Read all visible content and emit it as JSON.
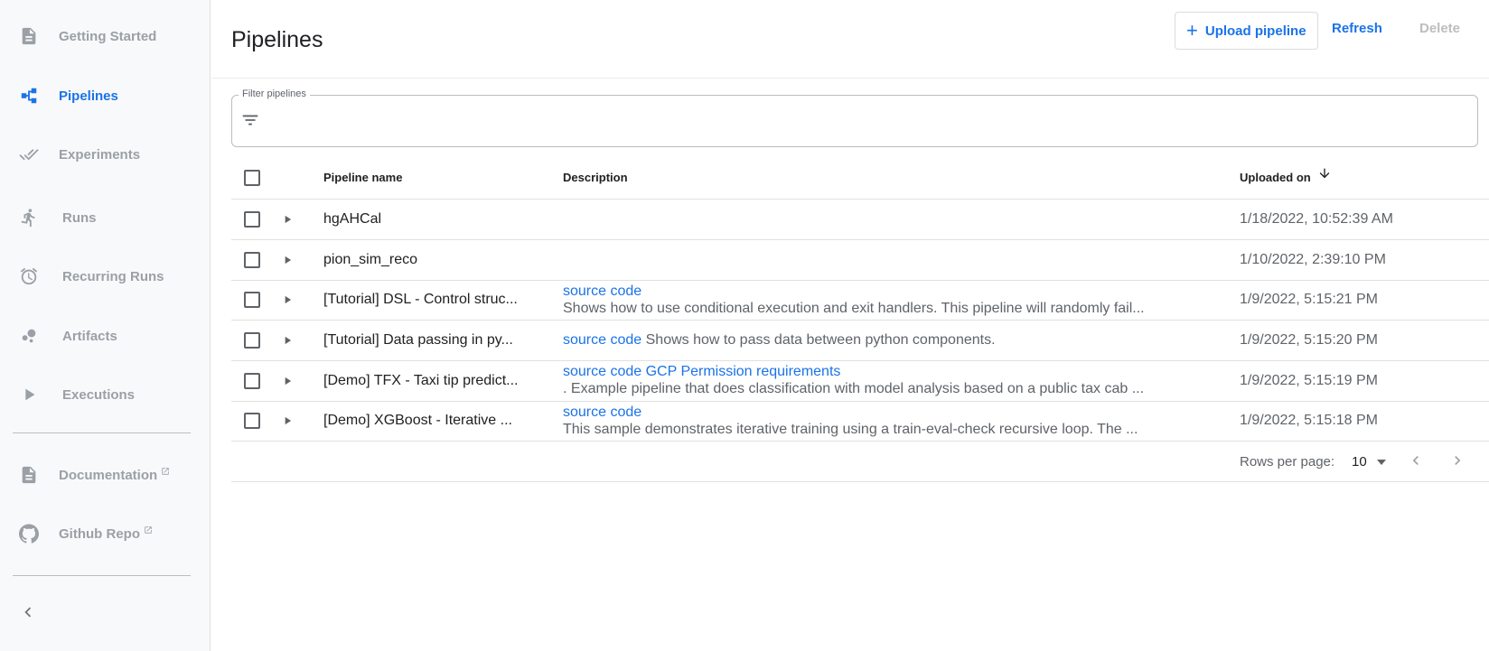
{
  "sidebar": {
    "items": [
      {
        "label": "Getting Started",
        "icon": "document-icon",
        "active": false
      },
      {
        "label": "Pipelines",
        "icon": "pipeline-icon",
        "active": true
      },
      {
        "label": "Experiments",
        "icon": "double-check-icon",
        "active": false
      },
      {
        "label": "Runs",
        "icon": "running-person-icon",
        "active": false
      },
      {
        "label": "Recurring Runs",
        "icon": "alarm-clock-icon",
        "active": false
      },
      {
        "label": "Artifacts",
        "icon": "bubbles-icon",
        "active": false
      },
      {
        "label": "Executions",
        "icon": "play-icon",
        "active": false
      }
    ],
    "external": [
      {
        "label": "Documentation",
        "icon": "document-icon"
      },
      {
        "label": "Github Repo",
        "icon": "github-icon"
      }
    ]
  },
  "header": {
    "title": "Pipelines",
    "upload_label": "Upload pipeline",
    "refresh_label": "Refresh",
    "delete_label": "Delete"
  },
  "filter": {
    "legend": "Filter pipelines",
    "value": ""
  },
  "table": {
    "columns": {
      "name": "Pipeline name",
      "description": "Description",
      "uploaded": "Uploaded on"
    },
    "sort": {
      "column": "uploaded",
      "direction": "descending"
    },
    "rows": [
      {
        "name": "hgAHCal",
        "links": "",
        "description": "",
        "uploaded": "1/18/2022, 10:52:39 AM"
      },
      {
        "name": "pion_sim_reco",
        "links": "",
        "description": "",
        "uploaded": "1/10/2022, 2:39:10 PM"
      },
      {
        "name": "[Tutorial] DSL - Control struc...",
        "links": "source code",
        "description": "Shows how to use conditional execution and exit handlers. This pipeline will randomly fail...",
        "uploaded": "1/9/2022, 5:15:21 PM"
      },
      {
        "name": "[Tutorial] Data passing in py...",
        "links": "source code",
        "description": "Shows how to pass data between python components.",
        "uploaded": "1/9/2022, 5:15:20 PM"
      },
      {
        "name": "[Demo] TFX - Taxi tip predict...",
        "links": "source code GCP Permission requirements",
        "description": ". Example pipeline that does classification with model analysis based on a public tax cab ...",
        "uploaded": "1/9/2022, 5:15:19 PM"
      },
      {
        "name": "[Demo] XGBoost - Iterative ...",
        "links": "source code",
        "description": "This sample demonstrates iterative training using a train-eval-check recursive loop. The ...",
        "uploaded": "1/9/2022, 5:15:18 PM"
      }
    ]
  },
  "pagination": {
    "rows_per_page_label": "Rows per page:",
    "rows_per_page": "10"
  },
  "colors": {
    "accent": "#1a73e8",
    "sidebar_bg": "#f8f9fa",
    "muted": "#9aa0a6"
  }
}
